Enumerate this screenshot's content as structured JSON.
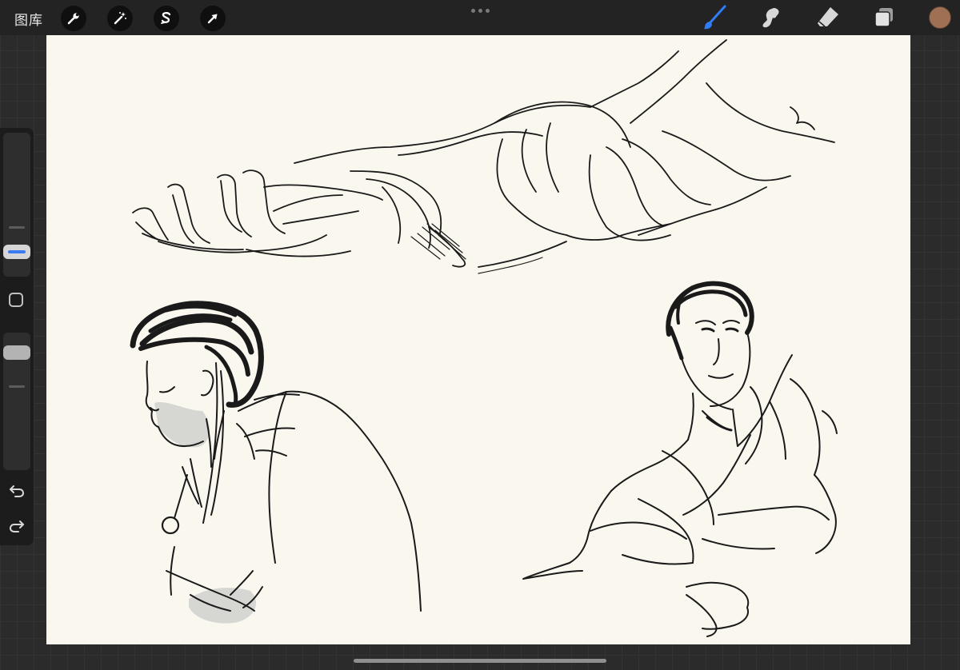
{
  "toolbar": {
    "gallery_label": "图库",
    "left_tools": [
      "wrench-icon",
      "magic-wand-icon",
      "selection-icon",
      "transform-arrow-icon"
    ],
    "right_tools": [
      "brush-icon",
      "smudge-icon",
      "eraser-icon",
      "layers-icon"
    ],
    "active_tool": "brush-icon",
    "accent_color": "#2f7cf6",
    "current_color": "#a07055"
  },
  "canvas": {
    "background_color": "#faf7ee",
    "ink_color": "#1a1a1a",
    "shading_color": "#d6d6d3"
  },
  "sidebar": {
    "brush_size_level": 0.62,
    "opacity_level": 0.12,
    "icons": [
      "undo-icon",
      "redo-icon"
    ]
  }
}
